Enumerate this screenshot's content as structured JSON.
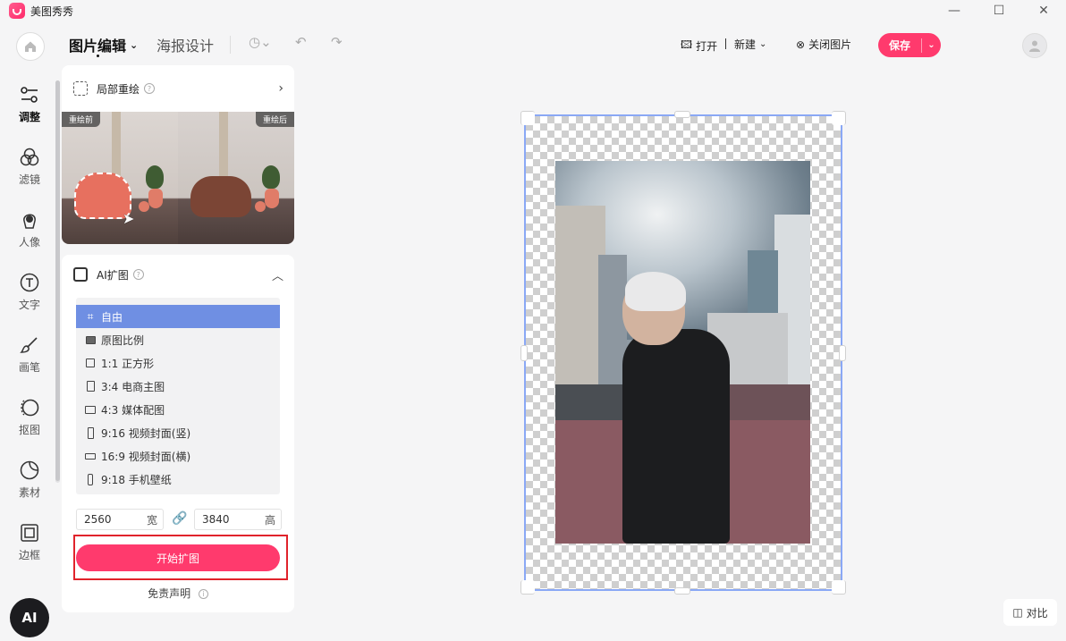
{
  "app": {
    "title": "美图秀秀"
  },
  "toolbar": {
    "tabs": [
      {
        "label": "图片编辑"
      },
      {
        "label": "海报设计"
      }
    ],
    "open_label": "打开",
    "new_label": "新建",
    "close_image_label": "关闭图片",
    "save_label": "保存"
  },
  "leftnav": {
    "items": [
      {
        "label": "调整",
        "icon": "sliders-icon"
      },
      {
        "label": "滤镜",
        "icon": "filter-icon"
      },
      {
        "label": "人像",
        "icon": "portrait-icon"
      },
      {
        "label": "文字",
        "icon": "text-icon"
      },
      {
        "label": "画笔",
        "icon": "brush-icon"
      },
      {
        "label": "抠图",
        "icon": "cutout-icon"
      },
      {
        "label": "素材",
        "icon": "sticker-icon"
      },
      {
        "label": "边框",
        "icon": "frame-icon"
      }
    ],
    "ai_label": "AI"
  },
  "panel": {
    "repaint": {
      "title": "局部重绘",
      "before_label": "重绘前",
      "after_label": "重绘后"
    },
    "expand": {
      "title": "AI扩图",
      "ratios": [
        {
          "label": "自由",
          "active": true
        },
        {
          "label": "原图比例"
        },
        {
          "label": "1:1 正方形"
        },
        {
          "label": "3:4 电商主图"
        },
        {
          "label": "4:3 媒体配图"
        },
        {
          "label": "9:16 视频封面(竖)"
        },
        {
          "label": "16:9 视频封面(横)"
        },
        {
          "label": "9:18 手机壁纸"
        }
      ],
      "width_value": "2560",
      "width_unit": "宽",
      "height_value": "3840",
      "height_unit": "高",
      "start_label": "开始扩图",
      "disclaimer_label": "免责声明"
    }
  },
  "canvas": {
    "compare_label": "对比"
  },
  "colors": {
    "accent": "#ff3a6d",
    "selection": "#6f8fe3",
    "canvas_border": "#8aa8f5"
  }
}
